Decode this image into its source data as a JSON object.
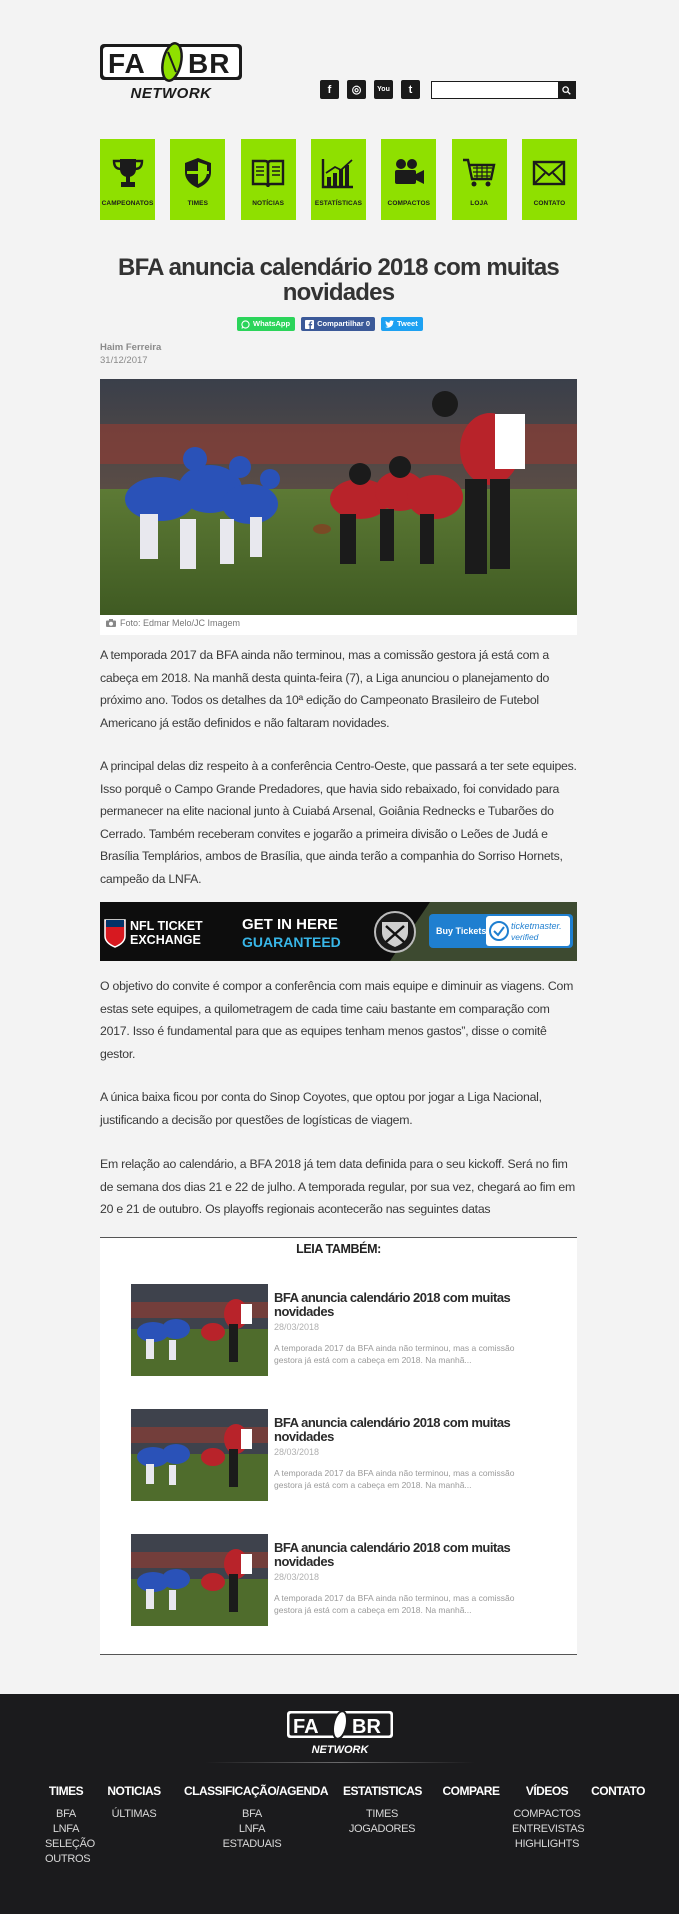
{
  "brand": {
    "logo_top": "FA",
    "logo_right": "BR",
    "logo_sub": "NETWORK",
    "accent": "#8fe000"
  },
  "header": {
    "social": [
      {
        "name": "facebook-icon",
        "glyph": "f"
      },
      {
        "name": "instagram-icon",
        "glyph": "◎"
      },
      {
        "name": "youtube-icon",
        "glyph": "You"
      },
      {
        "name": "twitter-icon",
        "glyph": "t"
      }
    ],
    "search": {
      "placeholder": "",
      "value": ""
    }
  },
  "nav": [
    {
      "label": "CAMPEONATOS",
      "icon": "trophy-icon"
    },
    {
      "label": "TIMES",
      "icon": "shield-icon"
    },
    {
      "label": "NOTÍCIAS",
      "icon": "book-icon"
    },
    {
      "label": "ESTATÍSTICAS",
      "icon": "chart-icon"
    },
    {
      "label": "COMPACTOS",
      "icon": "camera-icon"
    },
    {
      "label": "LOJA",
      "icon": "cart-icon"
    },
    {
      "label": "CONTATO",
      "icon": "mail-icon"
    }
  ],
  "article": {
    "title": "BFA anuncia calendário 2018 com muitas novidades",
    "share": {
      "whatsapp": "WhatsApp",
      "facebook": "Compartilhar 0",
      "twitter": "Tweet"
    },
    "author": "Haim Ferreira",
    "date": "31/12/2017",
    "photo_credit": "Foto: Edmar Melo/JC Imagem",
    "paragraphs": [
      "A temporada 2017 da BFA ainda não terminou, mas a comissão gestora já está com a cabeça em 2018. Na manhã desta quinta-feira (7), a Liga anunciou o planejamento do próximo ano. Todos os detalhes da 10ª edição do Campeonato Brasileiro de Futebol Americano já estão definidos e não faltaram novidades.",
      "A principal delas diz respeito à a conferência Centro-Oeste, que passará a ter sete equipes. Isso porquê o Campo Grande Predadores, que havia sido rebaixado, foi convidado para permanecer na elite nacional junto à Cuiabá Arsenal, Goiânia Rednecks e Tubarões do Cerrado. Também receberam convites e jogarão a primeira divisão o Leões de Judá e Brasília Templários, ambos de Brasília, que ainda terão a companhia do Sorriso Hornets, campeão da LNFA.",
      "O objetivo do convite é compor a conferência com mais equipe e diminuir as viagens. Com estas sete equipes, a quilometragem de cada time caiu bastante em comparação com 2017. Isso é fundamental para que as equipes tenham menos gastos”, disse o comitê gestor.",
      "A única baixa ficou por conta do Sinop Coyotes, que optou por jogar a Liga Nacional, justificando a decisão por questões de logísticas de viagem.",
      "Em relação ao calendário, a BFA 2018 já tem data definida para o seu kickoff. Será no fim de semana dos dias 21 e 22 de julho. A temporada regular, por sua vez, chegará ao fim em 20 e 21 de outubro.  Os playoffs regionais acontecerão nas seguintes datas"
    ]
  },
  "ad": {
    "brand_line1": "NFL TICKET",
    "brand_line2": "EXCHANGE",
    "headline1": "GET IN HERE",
    "headline2": "GUARANTEED",
    "cta": "Buy Tickets",
    "partner1": "ticketmaster.",
    "partner2": "verified"
  },
  "also": {
    "heading": "LEIA TAMBÉM:",
    "items": [
      {
        "title": "BFA anuncia calendário 2018 com muitas novidades",
        "date": "28/03/2018",
        "excerpt": "A temporada 2017 da BFA ainda não terminou, mas a comissão gestora já está com a cabeça em 2018. Na manhã..."
      },
      {
        "title": "BFA anuncia calendário 2018 com muitas novidades",
        "date": "28/03/2018",
        "excerpt": "A temporada 2017 da BFA ainda não terminou, mas a comissão gestora já está com a cabeça em 2018. Na manhã..."
      },
      {
        "title": "BFA anuncia calendário 2018 com muitas novidades",
        "date": "28/03/2018",
        "excerpt": "A temporada 2017 da BFA ainda não terminou, mas a comissão gestora já está com a cabeça em 2018. Na manhã..."
      }
    ]
  },
  "footer": {
    "columns": [
      {
        "heading": "TIMES",
        "items": [
          "BFA",
          "LNFA",
          "SELEÇÃO",
          "OUTROS"
        ]
      },
      {
        "heading": "NOTICIAS",
        "items": [
          "ÚLTIMAS"
        ]
      },
      {
        "heading": "CLASSIFICAÇÃO/AGENDA",
        "items": [
          "BFA",
          "LNFA",
          "ESTADUAIS"
        ]
      },
      {
        "heading": "ESTATISTICAS",
        "items": [
          "TIMES",
          "JOGADORES"
        ]
      },
      {
        "heading": "COMPARE",
        "items": []
      },
      {
        "heading": "VÍDEOS",
        "items": [
          "COMPACTOS",
          "ENTREVISTAS",
          "HIGHLIGHTS"
        ]
      },
      {
        "heading": "CONTATO",
        "items": []
      }
    ]
  }
}
